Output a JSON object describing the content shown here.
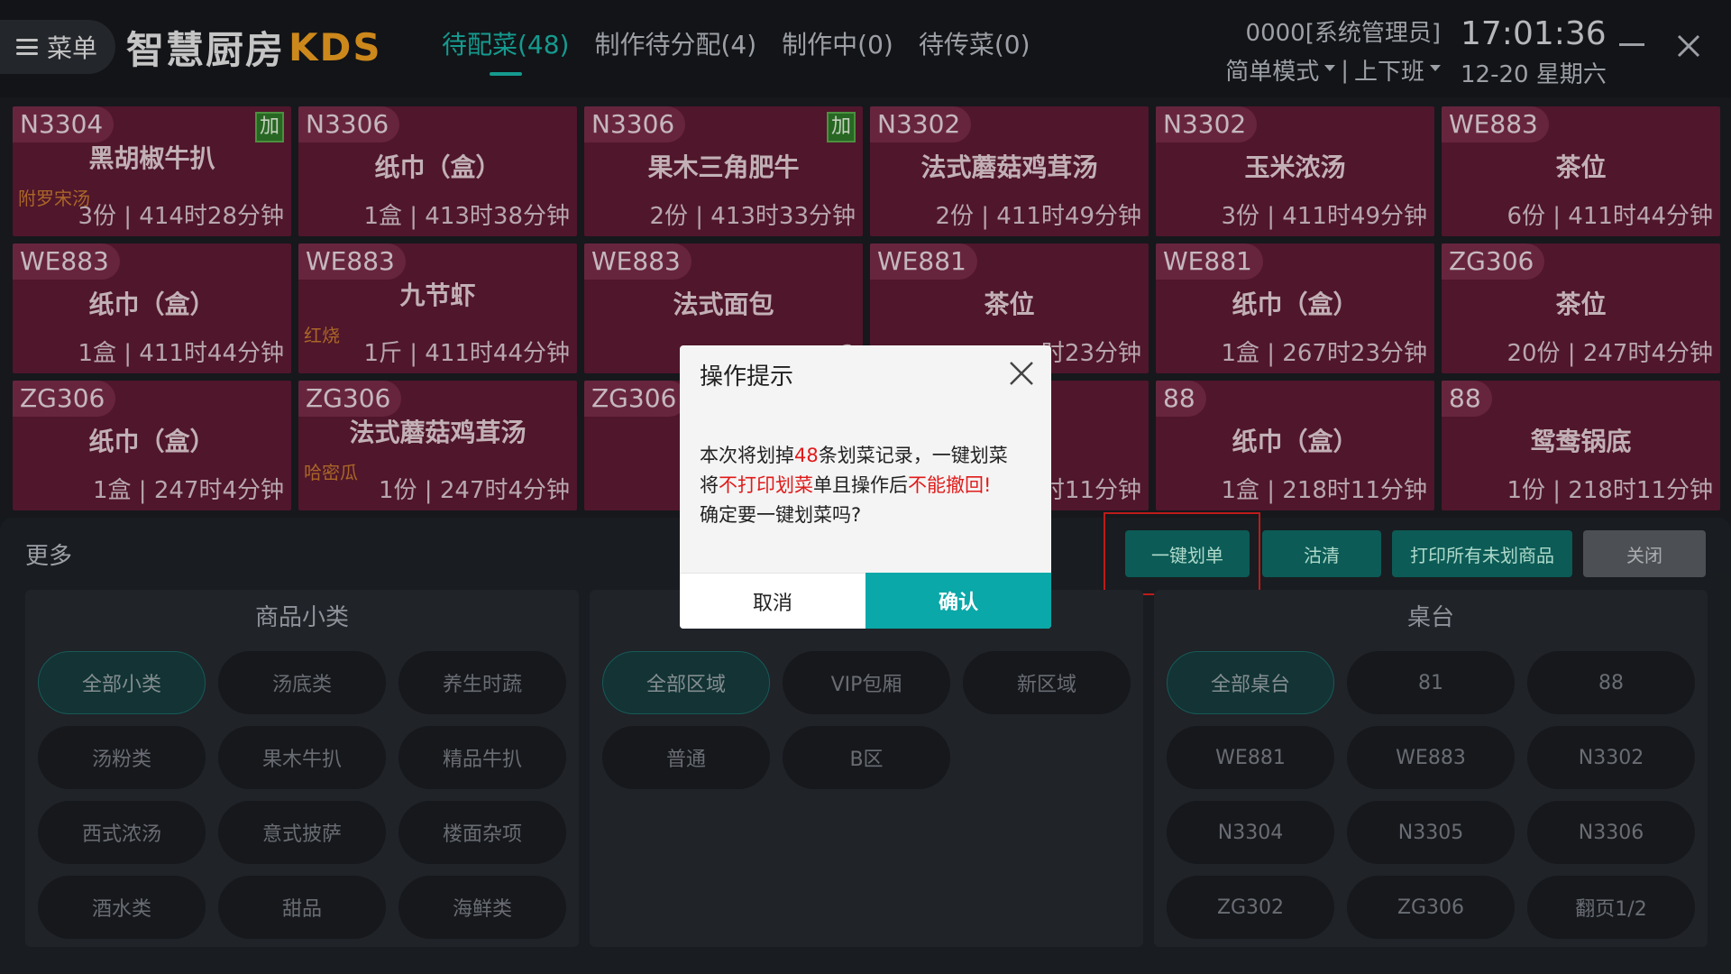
{
  "header": {
    "menu_label": "菜单",
    "brand_cn": "智慧厨房",
    "brand_kds": "KDS",
    "tabs": [
      {
        "label": "待配菜(48)"
      },
      {
        "label": "制作待分配(4)"
      },
      {
        "label": "制作中(0)"
      },
      {
        "label": "待传菜(0)"
      }
    ],
    "user": "0000[系统管理员]",
    "mode": "简单模式",
    "separator": "|",
    "shift": "上下班",
    "time": "17:01:36",
    "date": "12-20 星期六"
  },
  "cards": [
    {
      "table": "N3304",
      "dish": "黑胡椒牛扒",
      "note": "附罗宋汤",
      "meta": "3份 | 414时28分钟",
      "add": "加"
    },
    {
      "table": "N3306",
      "dish": "纸巾（盒）",
      "note": "",
      "meta": "1盒 | 413时38分钟",
      "add": ""
    },
    {
      "table": "N3306",
      "dish": "果木三角肥牛",
      "note": "",
      "meta": "2份 | 413时33分钟",
      "add": "加"
    },
    {
      "table": "N3302",
      "dish": "法式蘑菇鸡茸汤",
      "note": "",
      "meta": "2份 | 411时49分钟",
      "add": ""
    },
    {
      "table": "N3302",
      "dish": "玉米浓汤",
      "note": "",
      "meta": "3份 | 411时49分钟",
      "add": ""
    },
    {
      "table": "WE883",
      "dish": "茶位",
      "note": "",
      "meta": "6份 | 411时44分钟",
      "add": ""
    },
    {
      "table": "WE883",
      "dish": "纸巾（盒）",
      "note": "",
      "meta": "1盒 | 411时44分钟",
      "add": ""
    },
    {
      "table": "WE883",
      "dish": "九节虾",
      "note": "红烧",
      "meta": "1斤 | 411时44分钟",
      "add": ""
    },
    {
      "table": "WE883",
      "dish": "法式面包",
      "note": "",
      "meta": "2",
      "add": ""
    },
    {
      "table": "WE881",
      "dish": "茶位",
      "note": "",
      "meta": "时23分钟",
      "add": ""
    },
    {
      "table": "WE881",
      "dish": "纸巾（盒）",
      "note": "",
      "meta": "1盒 | 267时23分钟",
      "add": ""
    },
    {
      "table": "ZG306",
      "dish": "茶位",
      "note": "",
      "meta": "20份 | 247时4分钟",
      "add": ""
    },
    {
      "table": "ZG306",
      "dish": "纸巾（盒）",
      "note": "",
      "meta": "1盒 | 247时4分钟",
      "add": ""
    },
    {
      "table": "ZG306",
      "dish": "法式蘑菇鸡茸汤",
      "note": "哈密瓜",
      "meta": "1份 | 247时4分钟",
      "add": ""
    },
    {
      "table": "ZG306",
      "dish": "",
      "note": "",
      "meta": "",
      "add": ""
    },
    {
      "table": "",
      "dish": "",
      "note": "",
      "meta": "时11分钟",
      "add": ""
    },
    {
      "table": "88",
      "dish": "纸巾（盒）",
      "note": "",
      "meta": "1盒 | 218时11分钟",
      "add": ""
    },
    {
      "table": "88",
      "dish": "鸳鸯锅底",
      "note": "",
      "meta": "1份 | 218时11分钟",
      "add": ""
    }
  ],
  "more": {
    "title": "更多",
    "actions": {
      "one_click": "一键划单",
      "clear": "沽清",
      "print_all": "打印所有未划商品",
      "close": "关闭"
    },
    "groups": [
      {
        "title": "商品小类",
        "items": [
          "全部小类",
          "汤底类",
          "养生时蔬",
          "汤粉类",
          "果木牛扒",
          "精品牛扒",
          "西式浓汤",
          "意式披萨",
          "楼面杂项",
          "酒水类",
          "甜品",
          "海鲜类"
        ]
      },
      {
        "title": "",
        "items": [
          "全部区域",
          "VIP包厢",
          "新区域",
          "普通",
          "B区"
        ]
      },
      {
        "title": "桌台",
        "items": [
          "全部桌台",
          "81",
          "88",
          "WE881",
          "WE883",
          "N3302",
          "N3304",
          "N3305",
          "N3306",
          "ZG302",
          "ZG306",
          "翻页1/2"
        ]
      }
    ]
  },
  "dialog": {
    "title": "操作提示",
    "line1_a": "本次将划掉",
    "line1_count": "48",
    "line1_b": "条划菜记录，一键划菜",
    "line2_a": "将",
    "line2_red1": "不打印划菜",
    "line2_b": "单且操作后",
    "line2_red2": "不能撤回!",
    "line3": "确定要一键划菜吗?",
    "cancel": "取消",
    "confirm": "确认"
  }
}
